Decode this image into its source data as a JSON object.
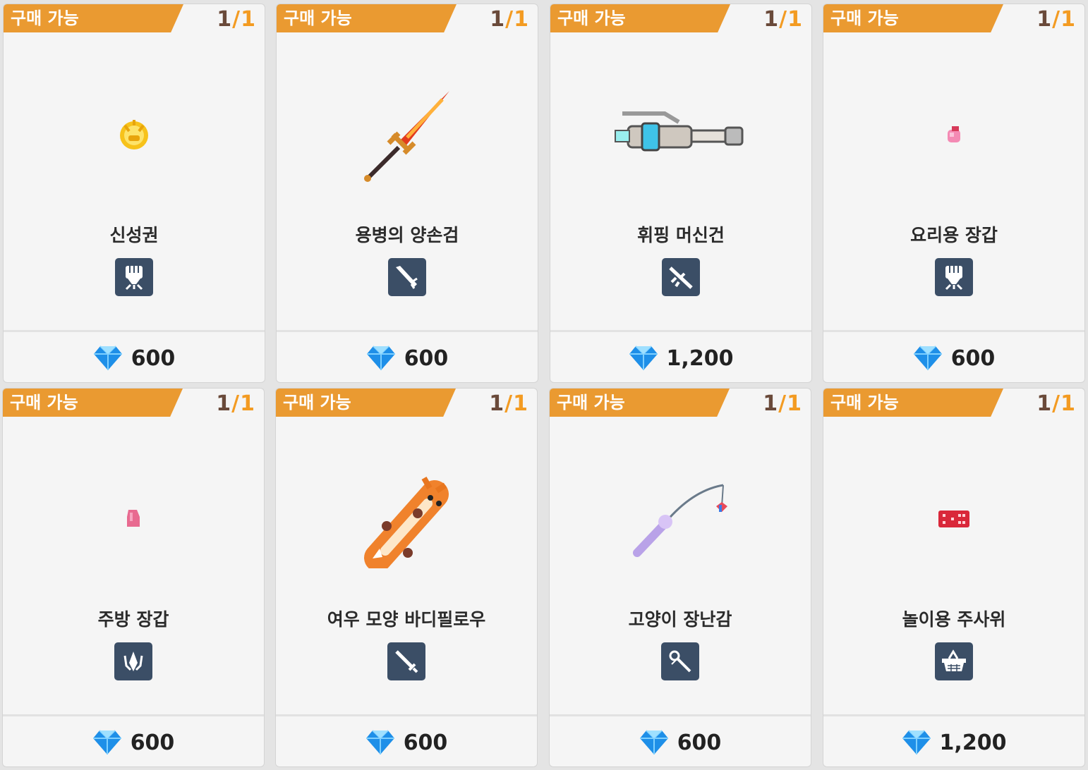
{
  "cards": [
    {
      "badge": "구매 가능",
      "stock_current": "1",
      "stock_sep": "/",
      "stock_max": "1",
      "name": "신성권",
      "price": "600",
      "icon": "fist-icon",
      "art": "holy-fist"
    },
    {
      "badge": "구매 가능",
      "stock_current": "1",
      "stock_sep": "/",
      "stock_max": "1",
      "name": "용병의 양손검",
      "price": "600",
      "icon": "greatsword-icon",
      "art": "flame-sword"
    },
    {
      "badge": "구매 가능",
      "stock_current": "1",
      "stock_sep": "/",
      "stock_max": "1",
      "name": "휘핑 머신건",
      "price": "1,200",
      "icon": "rifle-icon",
      "art": "machine-gun"
    },
    {
      "badge": "구매 가능",
      "stock_current": "1",
      "stock_sep": "/",
      "stock_max": "1",
      "name": "요리용 장갑",
      "price": "600",
      "icon": "fist-icon",
      "art": "pink-glove"
    },
    {
      "badge": "구매 가능",
      "stock_current": "1",
      "stock_sep": "/",
      "stock_max": "1",
      "name": "주방 장갑",
      "price": "600",
      "icon": "claw-icon",
      "art": "pink-mitten"
    },
    {
      "badge": "구매 가능",
      "stock_current": "1",
      "stock_sep": "/",
      "stock_max": "1",
      "name": "여우 모양 바디필로우",
      "price": "600",
      "icon": "sword-icon",
      "art": "fox-pillow"
    },
    {
      "badge": "구매 가능",
      "stock_current": "1",
      "stock_sep": "/",
      "stock_max": "1",
      "name": "고양이 장난감",
      "price": "600",
      "icon": "staff-icon",
      "art": "cat-toy"
    },
    {
      "badge": "구매 가능",
      "stock_current": "1",
      "stock_sep": "/",
      "stock_max": "1",
      "name": "놀이용 주사위",
      "price": "1,200",
      "icon": "basket-icon",
      "art": "red-dice"
    }
  ],
  "colors": {
    "badge": "#ea9a31",
    "type_icon_bg": "#3b4e66",
    "gem": "#1e8fe8"
  }
}
